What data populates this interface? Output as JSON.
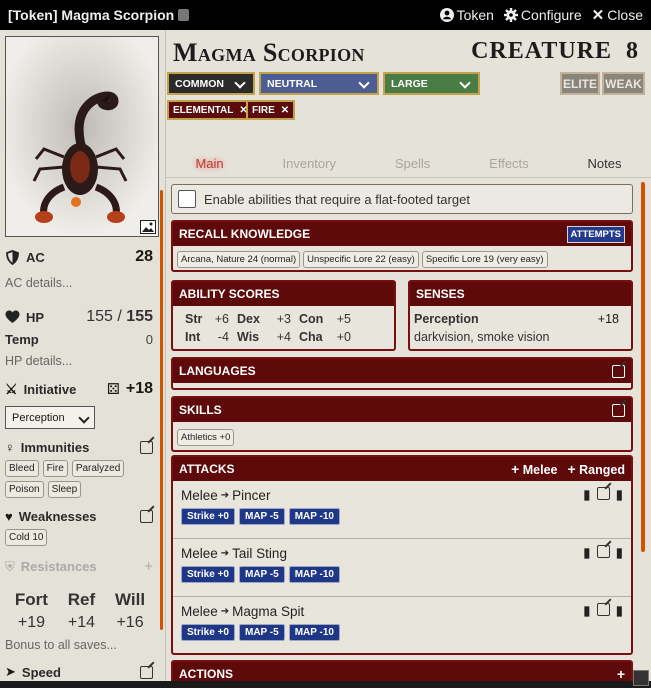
{
  "window": {
    "title": "[Token] Magma Scorpion",
    "token_label": "Token",
    "configure_label": "Configure",
    "close_label": "Close"
  },
  "sidebar": {
    "ac_label": "AC",
    "ac_value": "28",
    "ac_details": "AC details...",
    "hp_label": "HP",
    "hp_value": "155",
    "hp_sep": "/",
    "hp_max": "155",
    "temp_label": "Temp",
    "temp_value": "0",
    "hp_details": "HP details...",
    "initiative_label": "Initiative",
    "initiative_value": "+18",
    "initiative_select": "Perception",
    "immunities_label": "Immunities",
    "immunities": [
      "Bleed",
      "Fire",
      "Paralyzed",
      "Poison",
      "Sleep"
    ],
    "weaknesses_label": "Weaknesses",
    "weaknesses": [
      "Cold 10"
    ],
    "resistances_label": "Resistances",
    "saves": [
      {
        "name": "Fort",
        "value": "+19"
      },
      {
        "name": "Ref",
        "value": "+14"
      },
      {
        "name": "Will",
        "value": "+16"
      }
    ],
    "saves_note": "Bonus to all saves...",
    "speed_label": "Speed"
  },
  "header": {
    "name": "Magma Scorpion",
    "creature_label": "CREATURE",
    "level": "8",
    "rarity": "COMMON",
    "alignment": "NEUTRAL",
    "size": "LARGE",
    "elite": "ELITE",
    "weak": "WEAK",
    "traits": [
      "ELEMENTAL",
      "FIRE"
    ]
  },
  "tabs": [
    "Main",
    "Inventory",
    "Spells",
    "Effects",
    "Notes"
  ],
  "main": {
    "flatfooted_label": "Enable abilities that require a flat-footed target",
    "recall_title": "RECALL KNOWLEDGE",
    "attempts_label": "ATTEMPTS",
    "recall_tags": [
      "Arcana, Nature 24 (normal)",
      "Unspecific Lore 22 (easy)",
      "Specific Lore 19 (very easy)"
    ],
    "abilities_title": "ABILITY SCORES",
    "abilities": [
      {
        "k": "Str",
        "v": "+6"
      },
      {
        "k": "Dex",
        "v": "+3"
      },
      {
        "k": "Con",
        "v": "+5"
      },
      {
        "k": "Int",
        "v": "-4"
      },
      {
        "k": "Wis",
        "v": "+4"
      },
      {
        "k": "Cha",
        "v": "+0"
      }
    ],
    "senses_title": "SENSES",
    "perception_label": "Perception",
    "perception_value": "+18",
    "senses_text": "darkvision, smoke vision",
    "languages_title": "LANGUAGES",
    "skills_title": "SKILLS",
    "skills": [
      "Athletics +0"
    ],
    "attacks_title": "ATTACKS",
    "melee_label": "Melee",
    "ranged_label": "Ranged",
    "attacks": [
      {
        "type": "Melee",
        "name": "Pincer",
        "strike": "Strike +0",
        "map1": "MAP -5",
        "map2": "MAP -10"
      },
      {
        "type": "Melee",
        "name": "Tail Sting",
        "strike": "Strike +0",
        "map1": "MAP -5",
        "map2": "MAP -10"
      },
      {
        "type": "Melee",
        "name": "Magma Spit",
        "strike": "Strike +0",
        "map1": "MAP -5",
        "map2": "MAP -10"
      }
    ],
    "actions_title": "ACTIONS"
  },
  "colors": {
    "dark_red": "#5e0a0a",
    "common": "#2b2b2b",
    "neutral": "#4c5d93",
    "large": "#4a7c45",
    "strike": "#1f3787",
    "accent_scroll": "#d35400"
  }
}
